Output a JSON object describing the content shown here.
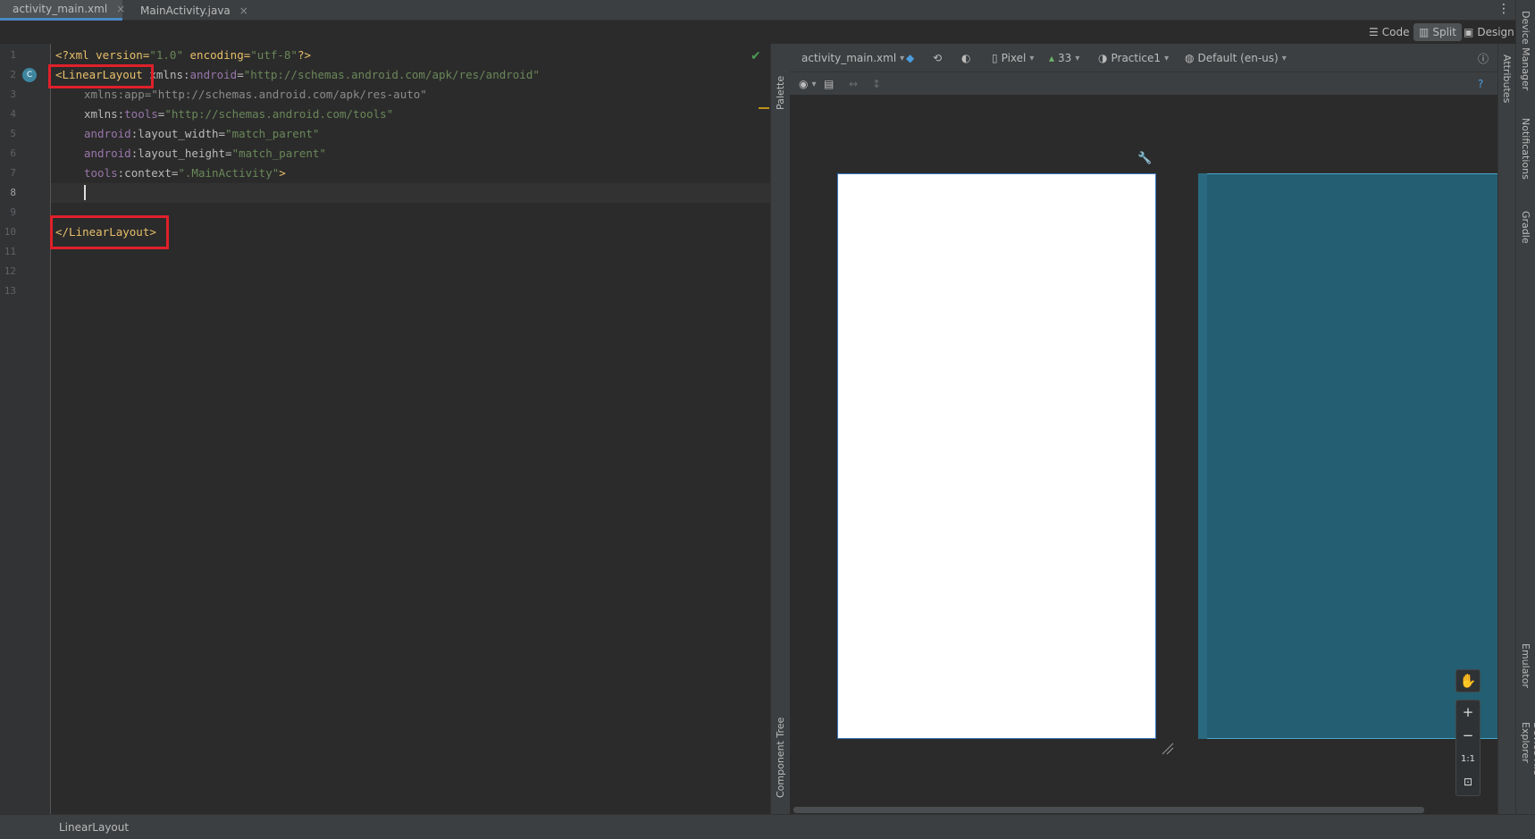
{
  "tabs": [
    {
      "label": "activity_main.xml",
      "active": true,
      "icon": "xml-file-icon"
    },
    {
      "label": "MainActivity.java",
      "active": false,
      "icon": "java-class-icon"
    }
  ],
  "view_modes": {
    "code": "Code",
    "split": "Split",
    "design": "Design",
    "active": "Split"
  },
  "editor": {
    "line_numbers": [
      "1",
      "2",
      "3",
      "4",
      "5",
      "6",
      "7",
      "8",
      "9",
      "10",
      "11",
      "12",
      "13"
    ],
    "lines": {
      "l1": {
        "a": "<?xml version=",
        "b": "\"1.0\"",
        "c": " encoding=",
        "d": "\"utf-8\"",
        "e": "?>"
      },
      "l2": {
        "tag": "<LinearLayout",
        "ns1": " xmlns:",
        "ns2": "android",
        "eq": "=",
        "val": "\"http://schemas.android.com/apk/res/android\""
      },
      "l3": {
        "text": "xmlns:app=\"http://schemas.android.com/apk/res-auto\""
      },
      "l4": {
        "a": "xmlns:",
        "ns": "tools",
        "eq": "=",
        "val": "\"http://schemas.android.com/tools\""
      },
      "l5": {
        "ns": "android",
        "a": ":layout_width=",
        "val": "\"match_parent\""
      },
      "l6": {
        "ns": "android",
        "a": ":layout_height=",
        "val": "\"match_parent\""
      },
      "l7": {
        "ns": "tools",
        "a": ":context=",
        "val": "\".MainActivity\"",
        "close": ">"
      },
      "l10": {
        "tag": "</LinearLayout>"
      }
    }
  },
  "side_panels": {
    "palette": "Palette",
    "component_tree": "Component Tree",
    "attributes": "Attributes"
  },
  "design_toolbar": {
    "file": "activity_main.xml",
    "device": "Pixel",
    "api": "33",
    "theme": "Practice1",
    "locale": "Default (en-us)"
  },
  "zoom_controls": {
    "plus": "+",
    "minus": "−",
    "one_to_one": "1:1"
  },
  "right_tools": [
    "Device Manager",
    "Notifications",
    "Gradle",
    "Emulator",
    "Device File Explorer"
  ],
  "status_bar": {
    "breadcrumb": "LinearLayout"
  },
  "colors": {
    "accent": "#4a88c7",
    "highlight_box": "#e0202a",
    "blueprint": "#235e72"
  }
}
